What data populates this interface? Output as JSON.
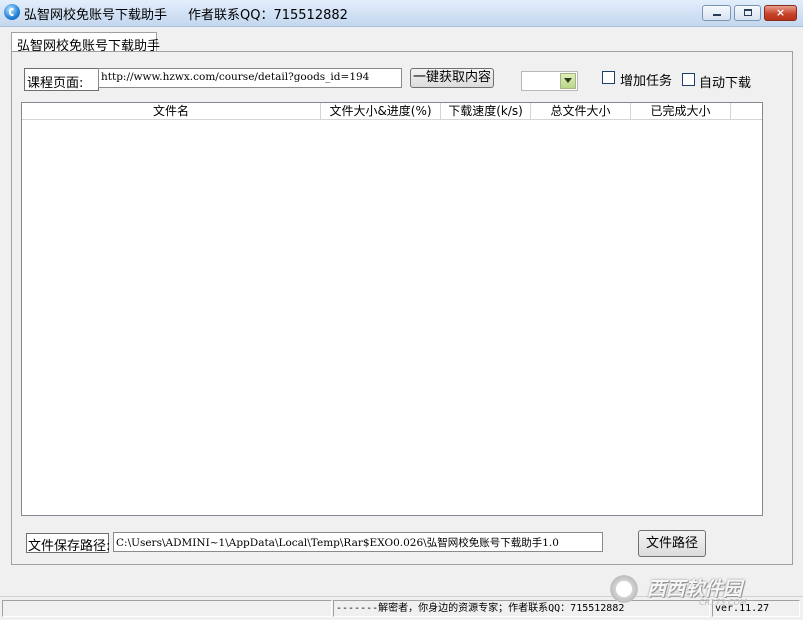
{
  "window": {
    "title": "弘智网校免账号下载助手",
    "author_qq": "作者联系QQ：715512882",
    "min_label": "",
    "max_label": "",
    "close_label": "×"
  },
  "tab": {
    "label": "弘智网校免账号下载助手"
  },
  "course": {
    "label": "课程页面:",
    "url": "http://www.hzwx.com/course/detail?goods_id=194",
    "fetch_button": "一键获取内容",
    "dropdown_value": ""
  },
  "options": {
    "add_task": "增加任务",
    "auto_download": "自动下载"
  },
  "table": {
    "columns": [
      "文件名",
      "文件大小&进度(%)",
      "下载速度(k/s)",
      "总文件大小",
      "已完成大小",
      ""
    ],
    "rows": []
  },
  "save": {
    "label": "文件保存路径:",
    "path": "C:\\Users\\ADMINI~1\\AppData\\Local\\Temp\\Rar$EXO0.026\\弘智网校免账号下载助手1.0",
    "button": "文件路径"
  },
  "status": {
    "pane1": "",
    "pane2": "-------解密者，你身边的资源专家；作者联系QQ：715512882",
    "pane3": "ver.11.27"
  },
  "watermark": {
    "text": "西西软件园",
    "url": "CR173.COM"
  },
  "colors": {
    "close": "#c8452c",
    "titlebar": "#cfe0f4"
  }
}
